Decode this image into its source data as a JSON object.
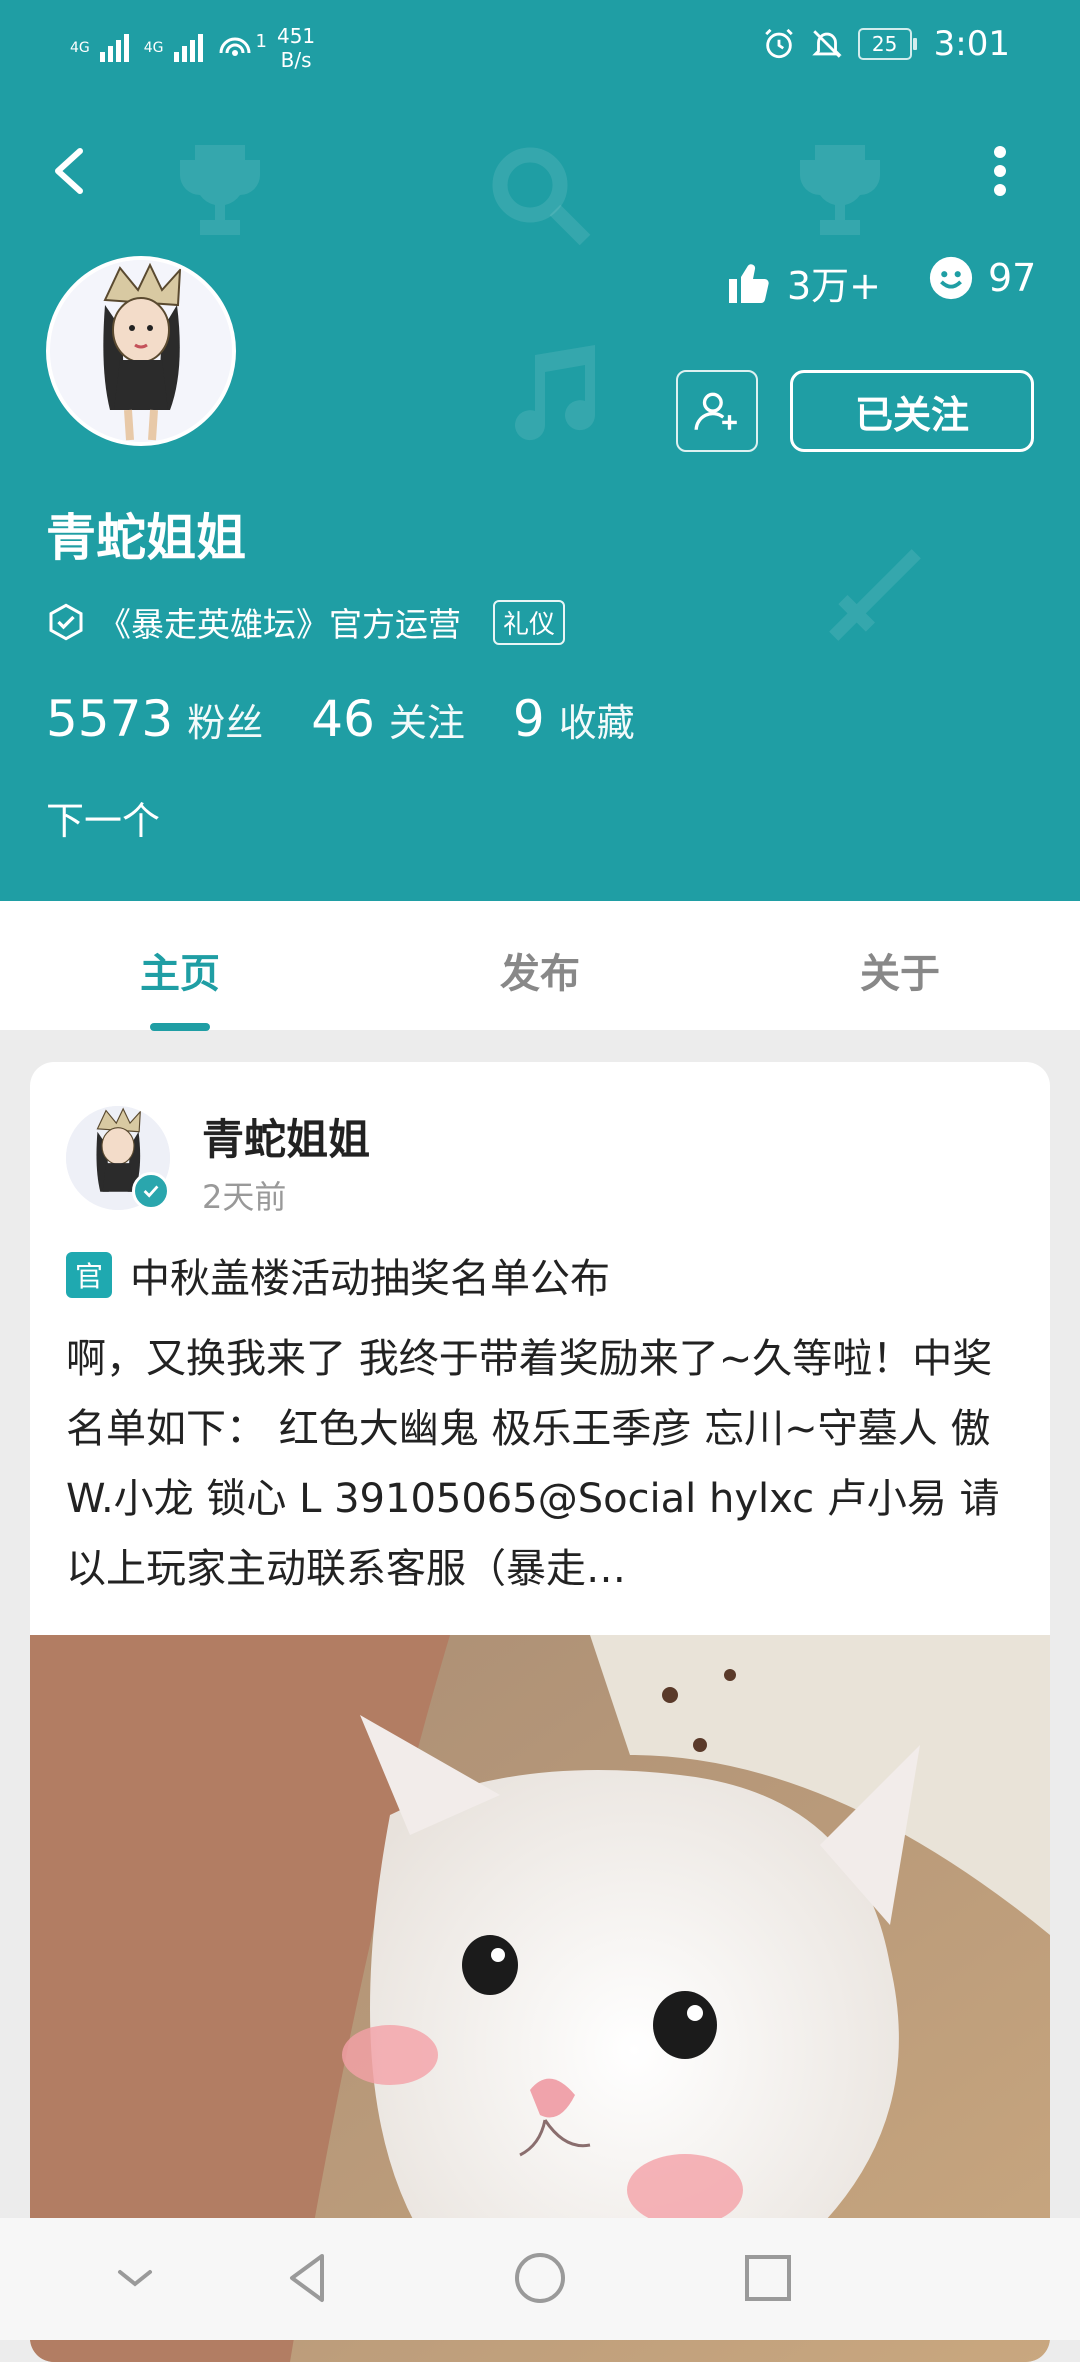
{
  "status_bar": {
    "signal_1": "4G",
    "signal_2": "4G",
    "hotspot_count": "1",
    "net_speed_value": "451",
    "net_speed_unit": "B/s",
    "battery": "25",
    "time": "3:01"
  },
  "profile": {
    "likes": "3万+",
    "smiles": "97",
    "follow_label": "已关注",
    "name": "青蛇姐姐",
    "verify_text": "《暴走英雄坛》官方运营",
    "tag": "礼仪",
    "stats": [
      {
        "value": "5573",
        "label": "粉丝"
      },
      {
        "value": "46",
        "label": "关注"
      },
      {
        "value": "9",
        "label": "收藏"
      }
    ],
    "next_label": "下一个"
  },
  "tabs": [
    {
      "label": "主页",
      "active": true
    },
    {
      "label": "发布",
      "active": false
    },
    {
      "label": "关于",
      "active": false
    }
  ],
  "post": {
    "author": "青蛇姐姐",
    "time": "2天前",
    "official_badge": "官",
    "title": "中秋盖楼活动抽奖名单公布",
    "body": "啊，又换我来了 我终于带着奖励来了~久等啦！中奖名单如下： 红色大幽鬼 极乐王季彦  忘川~守墓人  傲  W.小龙   锁心   L 39105065@Social hylxc  卢小易 请以上玩家主动联系客服（暴走…"
  },
  "colors": {
    "brand": "#1f9ea4",
    "tab_active": "#1f9ea4",
    "official_badge": "#1fa9b0"
  }
}
